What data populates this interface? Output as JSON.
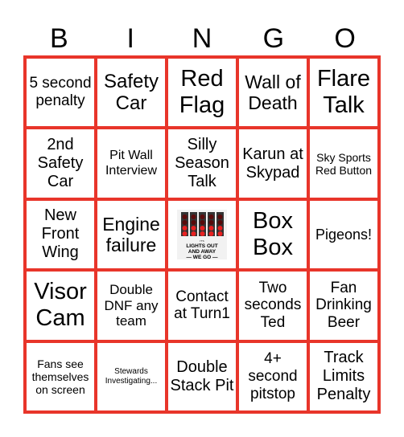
{
  "header": [
    "B",
    "I",
    "N",
    "G",
    "O"
  ],
  "colors": {
    "border": "#e8352a",
    "text": "#000000"
  },
  "cells": [
    {
      "text": "5 second penalty",
      "size": 19
    },
    {
      "text": "Safety Car",
      "size": 24
    },
    {
      "text": "Red Flag",
      "size": 29
    },
    {
      "text": "Wall of Death",
      "size": 23
    },
    {
      "text": "Flare Talk",
      "size": 29
    },
    {
      "text": "2nd Safety Car",
      "size": 20
    },
    {
      "text": "Pit Wall Interview",
      "size": 16
    },
    {
      "text": "Silly Season Talk",
      "size": 20
    },
    {
      "text": "Karun at Skypad",
      "size": 20
    },
    {
      "text": "Sky Sports Red Button",
      "size": 14
    },
    {
      "text": "New Front Wing",
      "size": 20
    },
    {
      "text": "Engine failure",
      "size": 23
    },
    {
      "text": "IT'S LIGHTS OUT AND AWAY WE GO",
      "free": true,
      "icon": "lights-out-logo"
    },
    {
      "text": "Box Box",
      "size": 29
    },
    {
      "text": "Pigeons!",
      "size": 18
    },
    {
      "text": "Visor Cam",
      "size": 29
    },
    {
      "text": "Double DNF any team",
      "size": 17
    },
    {
      "text": "Contact at Turn1",
      "size": 19
    },
    {
      "text": "Two seconds Ted",
      "size": 19
    },
    {
      "text": "Fan Drinking Beer",
      "size": 19
    },
    {
      "text": "Fans see themselves on screen",
      "size": 14
    },
    {
      "text": "Stewards Investigating...",
      "size": 10
    },
    {
      "text": "Double Stack Pit",
      "size": 20
    },
    {
      "text": "4+ second pitstop",
      "size": 19
    },
    {
      "text": "Track Limits Penalty",
      "size": 20
    }
  ]
}
